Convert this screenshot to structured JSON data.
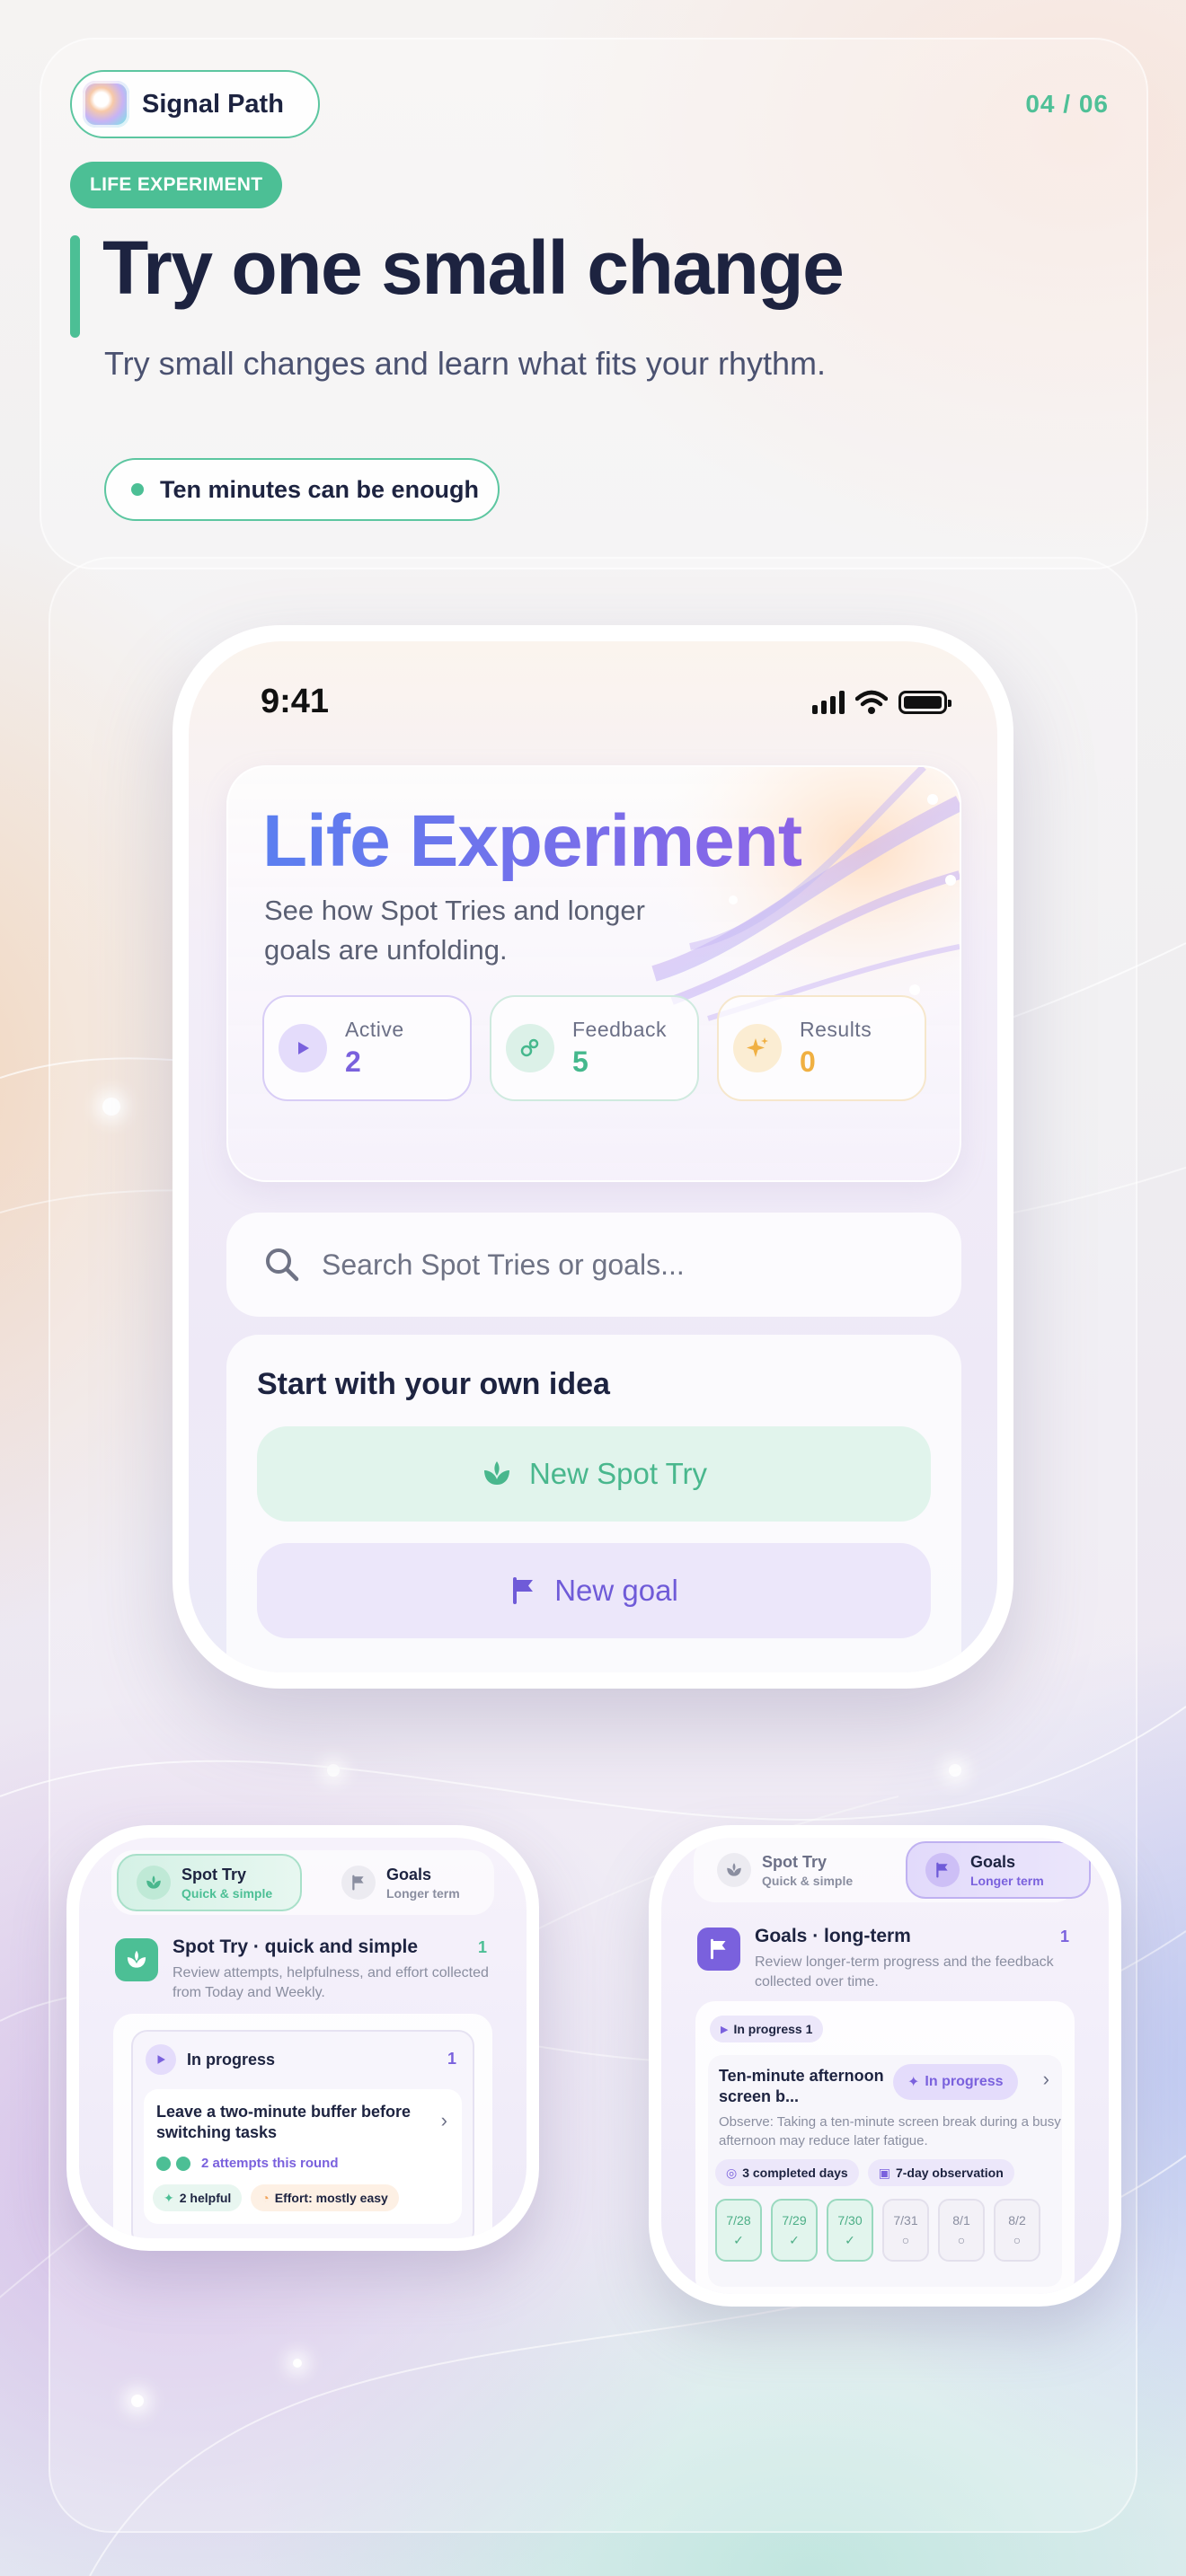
{
  "header": {
    "brand_name": "Signal Path",
    "page_indicator": "04 / 06",
    "tag": "LIFE EXPERIMENT",
    "headline": "Try one small change",
    "subheadline": "Try small changes and learn what fits your rhythm.",
    "pill_text": "Ten minutes can be enough"
  },
  "colors": {
    "accent_green": "#4cbf95",
    "accent_purple": "#7a61dd",
    "accent_amber": "#f0b042",
    "ink": "#1d2340"
  },
  "phone": {
    "time": "9:41",
    "hero": {
      "title": "Life Experiment",
      "subtitle": "See how Spot Tries and longer goals are unfolding."
    },
    "stats": [
      {
        "label": "Active",
        "value": "2",
        "icon": "play-icon"
      },
      {
        "label": "Feedback",
        "value": "5",
        "icon": "bubbles-icon"
      },
      {
        "label": "Results",
        "value": "0",
        "icon": "sparkle-icon"
      }
    ],
    "search_placeholder": "Search Spot Tries or goals...",
    "create": {
      "title": "Start with your own idea",
      "spot_button": "New Spot Try",
      "goal_button": "New goal"
    }
  },
  "mini_spot": {
    "tabs": [
      {
        "title": "Spot Try",
        "subtitle": "Quick & simple"
      },
      {
        "title": "Goals",
        "subtitle": "Longer term"
      }
    ],
    "section_title": "Spot Try · quick and simple",
    "section_count": "1",
    "section_desc": "Review attempts, helpfulness, and effort collected from Today and Weekly.",
    "group_label": "In progress",
    "group_count": "1",
    "item_title": "Leave a two-minute buffer before switching tasks",
    "attempts": "2 attempts this round",
    "chip_helpful": "2 helpful",
    "chip_effort": "Effort: mostly easy"
  },
  "mini_goals": {
    "tabs": [
      {
        "title": "Spot Try",
        "subtitle": "Quick & simple"
      },
      {
        "title": "Goals",
        "subtitle": "Longer term"
      }
    ],
    "section_title": "Goals · long-term",
    "section_count": "1",
    "section_desc": "Review longer-term progress and the feedback collected over time.",
    "filter_chip": "In progress 1",
    "item_title": "Ten-minute afternoon screen b...",
    "status": "In progress",
    "observe": "Observe: Taking a ten-minute screen break during a busy afternoon may reduce later fatigue.",
    "chip_days": "3 completed days",
    "chip_window": "7-day observation",
    "days": [
      {
        "date": "7/28",
        "done": true
      },
      {
        "date": "7/29",
        "done": true
      },
      {
        "date": "7/30",
        "done": true
      },
      {
        "date": "7/31",
        "done": false
      },
      {
        "date": "8/1",
        "done": false
      },
      {
        "date": "8/2",
        "done": false
      }
    ]
  }
}
